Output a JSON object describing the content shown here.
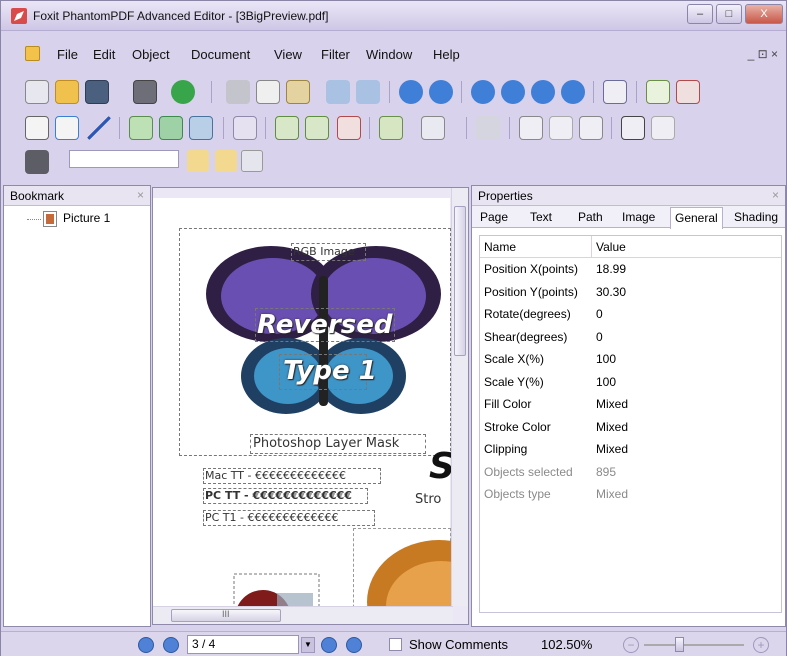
{
  "window": {
    "title": "Foxit PhantomPDF Advanced Editor - [3BigPreview.pdf]",
    "minimize": "–",
    "maximize": "□",
    "close": "X"
  },
  "menu": {
    "items": [
      "File",
      "Edit",
      "Object",
      "Document",
      "View",
      "Filter",
      "Window",
      "Help"
    ],
    "mdi_controls": "_ ⊡ ×"
  },
  "bookmark_pane": {
    "title": "Bookmark",
    "close": "×",
    "items": [
      {
        "label": "Picture 1"
      }
    ]
  },
  "document": {
    "labels": {
      "rgb_image": "RGB Image",
      "reversed": "Reversed",
      "type1": "Type 1",
      "photoshop_mask": "Photoshop Layer Mask",
      "mac_tt": "Mac TT - €€€€€€€€€€€€€",
      "pc_tt": "PC TT - €€€€€€€€€€€€€",
      "pc_t1": "PC T1 - €€€€€€€€€€€€€",
      "big_s": "S",
      "stro": "Stro"
    },
    "hscroll_mark": "III"
  },
  "properties": {
    "title": "Properties",
    "close": "×",
    "tabs": [
      "Page",
      "Text",
      "Path",
      "Image",
      "General",
      "Shading"
    ],
    "active_tab": "General",
    "columns": [
      "Name",
      "Value"
    ],
    "rows": [
      {
        "name": "Position X(points)",
        "value": "18.99"
      },
      {
        "name": "Position Y(points)",
        "value": "30.30"
      },
      {
        "name": "Rotate(degrees)",
        "value": "0"
      },
      {
        "name": "Shear(degrees)",
        "value": "0"
      },
      {
        "name": "Scale X(%)",
        "value": "100"
      },
      {
        "name": "Scale Y(%)",
        "value": "100"
      },
      {
        "name": "Fill Color",
        "value": "Mixed"
      },
      {
        "name": "Stroke Color",
        "value": "Mixed"
      },
      {
        "name": "Clipping",
        "value": "Mixed"
      },
      {
        "name": "Objects selected",
        "value": "895",
        "dim": true
      },
      {
        "name": "Objects type",
        "value": "Mixed",
        "dim": true
      }
    ]
  },
  "status": {
    "page": "3 / 4",
    "show_comments": "Show Comments",
    "zoom": "102.50%",
    "zoom_minus": "−",
    "zoom_plus": "+"
  }
}
